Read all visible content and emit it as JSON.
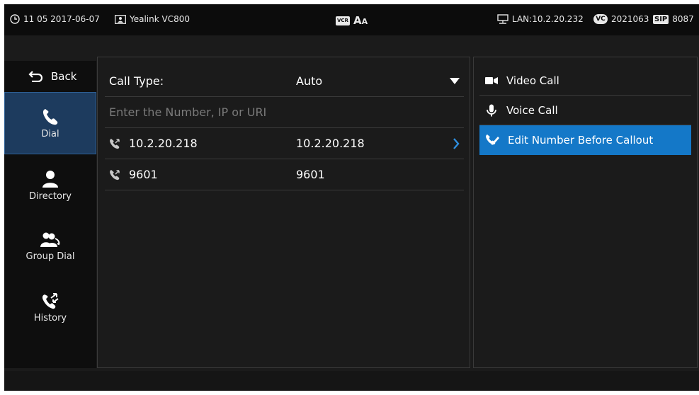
{
  "status_bar": {
    "time_date": "11 05 2017-06-07",
    "device_name": "Yealink VC800",
    "font_toggle": "A",
    "font_toggle_small": "A",
    "vcr_tag": "VCR",
    "lan": "LAN:10.2.20.232",
    "vc_badge": "VC",
    "vc_number": "2021063",
    "sip_tag": "SIP",
    "sip_number": "8087"
  },
  "sidebar": {
    "back_label": "Back",
    "items": [
      {
        "label": "Dial",
        "icon": "phone-icon",
        "active": true
      },
      {
        "label": "Directory",
        "icon": "person-icon",
        "active": false
      },
      {
        "label": "Group Dial",
        "icon": "group-icon",
        "active": false
      },
      {
        "label": "History",
        "icon": "history-icon",
        "active": false
      }
    ]
  },
  "dial": {
    "call_type_label": "Call Type:",
    "call_type_value": "Auto",
    "input_placeholder": "Enter the Number, IP or URI",
    "entries": [
      {
        "name": "10.2.20.218",
        "number": "10.2.20.218"
      },
      {
        "name": "9601",
        "number": "9601"
      }
    ]
  },
  "menu": {
    "items": [
      {
        "label": "Video Call",
        "icon": "video-camera-icon"
      },
      {
        "label": "Voice Call",
        "icon": "microphone-icon"
      },
      {
        "label": "Edit Number Before Callout",
        "icon": "phone-edit-icon",
        "selected": true
      }
    ]
  },
  "colors": {
    "accent": "#1478c8",
    "active_nav": "#1d3b5e",
    "background": "#1b1b1b"
  }
}
